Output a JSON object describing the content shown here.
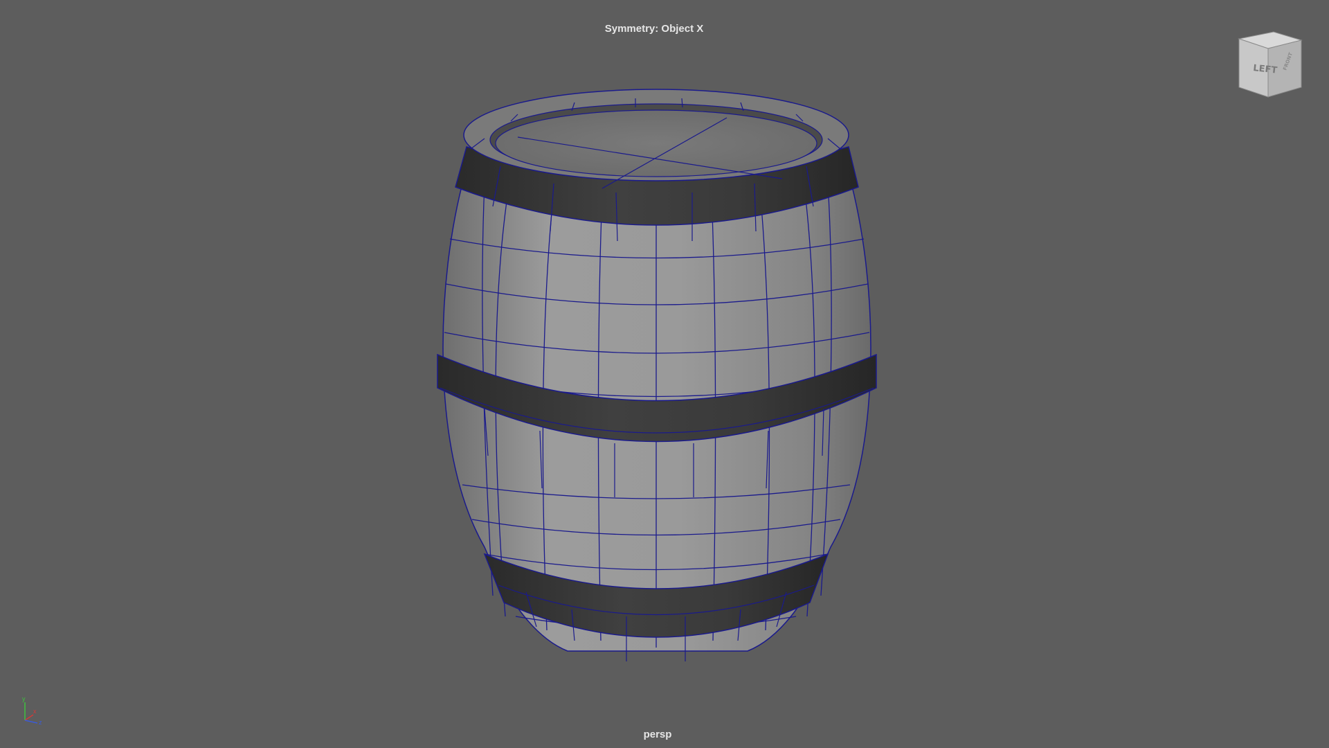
{
  "viewport": {
    "symmetry_label": "Symmetry: Object X",
    "camera_name": "persp",
    "background_color": "#5d5d5d"
  },
  "view_cube": {
    "front_face_label": "LEFT",
    "side_face_label": "FRONT",
    "icon": "view-cube-icon"
  },
  "axis_gizmo": {
    "icon": "axis-gizmo-icon",
    "axes": [
      "y",
      "x",
      "z"
    ],
    "colors": {
      "y": "#3ec13e",
      "x": "#d33a3a",
      "z": "#3a5bd9"
    }
  },
  "model": {
    "icon": "barrel-mesh",
    "wireframe_color": "#1a1a8c",
    "wood_color": "#9a9a9a",
    "band_color": "#3a3a3a"
  }
}
